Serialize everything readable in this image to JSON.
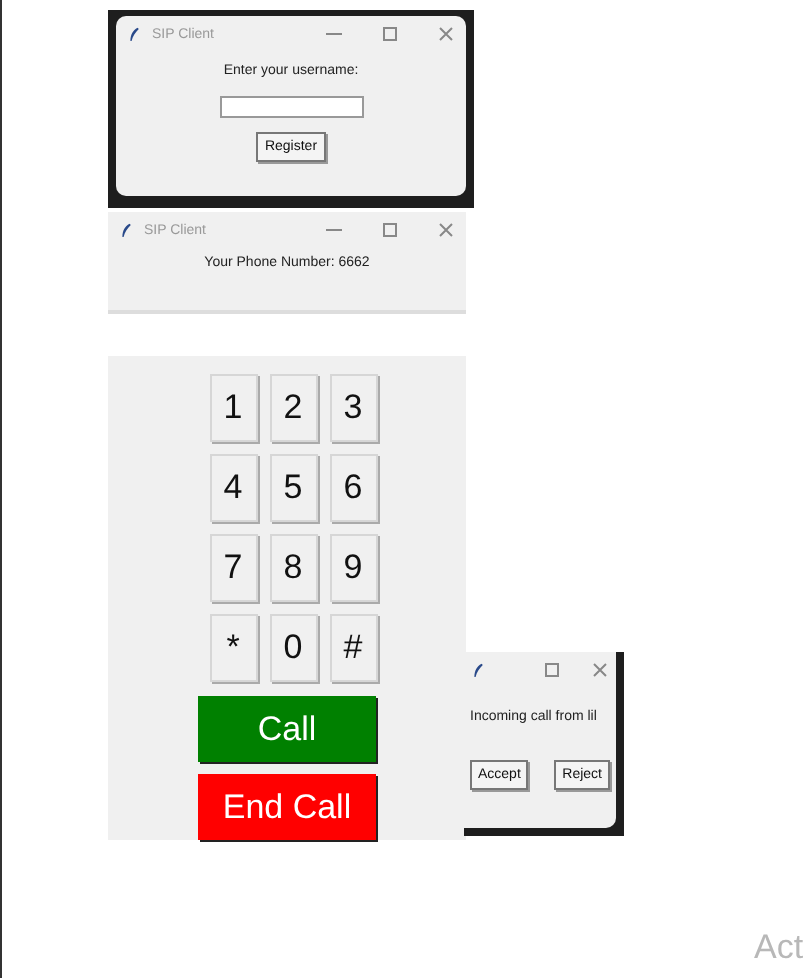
{
  "login_window": {
    "title": "SIP Client",
    "prompt": "Enter your username:",
    "button": "Register"
  },
  "phone_window": {
    "title": "SIP Client",
    "phone_number": "Your Phone Number: 6662"
  },
  "keypad": {
    "keys": [
      "1",
      "2",
      "3",
      "4",
      "5",
      "6",
      "7",
      "8",
      "9",
      "*",
      "0",
      "#"
    ],
    "call_button": "Call",
    "end_call_button": "End Call"
  },
  "incoming_window": {
    "message": "Incoming call from lil",
    "buttons": [
      "Accept",
      "Reject"
    ]
  },
  "desktop_text": "Act"
}
